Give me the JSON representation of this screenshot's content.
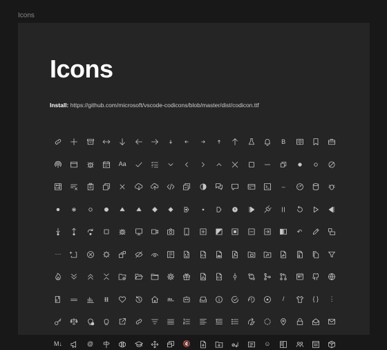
{
  "header": {
    "label": "Icons"
  },
  "main": {
    "title": "Icons",
    "install": {
      "label": "Install:",
      "url": "https://github.com/microsoft/vscode-codicons/blob/master/dist/codicon.ttf"
    }
  },
  "icon_color": "#c8c8c8",
  "icons": [
    [
      "link",
      "add",
      "archive",
      "arrow-both",
      "arrow-down",
      "arrow-left",
      "arrow-right",
      "arrow-small-down",
      "arrow-small-left",
      "arrow-small-right",
      "arrow-small-up",
      "arrow-up",
      "beaker",
      "bell",
      "bold",
      "book",
      "bookmark",
      "briefcase"
    ],
    [
      "broadcast",
      "browser",
      "bug",
      "calendar",
      "case-sensitive",
      "check",
      "checklist",
      "chevron-down",
      "chevron-left",
      "chevron-right",
      "chevron-up",
      "close",
      "chrome-maximize",
      "chrome-minimize",
      "chrome-restore",
      "circle-filled",
      "circle",
      "circle-slash"
    ],
    [
      "circuit-board",
      "clear-all",
      "clippy",
      "clone",
      "close-all",
      "cloud-download",
      "cloud-upload",
      "code",
      "collapse-all",
      "color-mode",
      "comment-discussion",
      "comment",
      "credit-card",
      "terminal",
      "dash",
      "dashboard",
      "database",
      "debug"
    ],
    [
      "debug-breakpoint",
      "debug-breakpoint-data",
      "debug-breakpoint-unverified",
      "debug-breakpoint-filled",
      "debug-stackframe-active",
      "debug-stackframe",
      "debug-breakpoint-conditional",
      "debug-breakpoint-log",
      "debug-stackframe-dot",
      "debug-breakpoint-function",
      "debug-hint",
      "debug-continue",
      "debug-disconnect",
      "debug-pause",
      "debug-restart",
      "debug-start",
      "debug-reverse-continue",
      "debug-step-back"
    ],
    [
      "debug-step-into",
      "debug-step-out",
      "debug-step-over",
      "debug-stop",
      "debug-alt",
      "device-desktop",
      "device-camera-video",
      "device-camera",
      "device-mobile",
      "diff-added",
      "diff-modified",
      "diff-removed",
      "diff-renamed",
      "diff-ignored",
      "diff",
      "discard",
      "edit",
      "editor-layout"
    ],
    [
      "ellipsis",
      "empty-window",
      "error",
      "exclude",
      "extensions",
      "eye-closed",
      "eye",
      "feedback",
      "file-binary",
      "file-code",
      "file-media",
      "file-pdf",
      "file-submodule",
      "file-symlink-directory",
      "file-symlink-file",
      "file-zip",
      "files",
      "filter"
    ],
    [
      "flame",
      "fold-down",
      "fold-up",
      "fold",
      "folder-active",
      "folder-opened",
      "folder",
      "gear",
      "gift",
      "gist-secret",
      "gist",
      "git-commit",
      "git-compare",
      "git-merge",
      "git-pull-request",
      "github-action",
      "github",
      "globe"
    ],
    [
      "grabber",
      "grip",
      "graph",
      "gripper",
      "heart",
      "history",
      "home",
      "horizontal-rule",
      "hubot",
      "inbox",
      "info",
      "issue-closed",
      "issue-reopened",
      "issues",
      "italic",
      "jersey",
      "json",
      "kebab-vertical"
    ],
    [
      "key",
      "law",
      "lightbulb-autofix",
      "lightbulb",
      "link-external",
      "link",
      "list-filter",
      "list-flat",
      "list-ordered",
      "list-selection",
      "list-tree",
      "list-unordered",
      "live-share",
      "loading",
      "location",
      "lock",
      "mail-read",
      "mail"
    ],
    [
      "markdown",
      "megaphone",
      "mention",
      "milestone",
      "mirror",
      "mortar-board",
      "move",
      "multiple-windows",
      "mute",
      "new-file",
      "new-folder",
      "no-newline",
      "note",
      "octoface",
      "open-preview",
      "organization",
      "output",
      "package"
    ]
  ]
}
